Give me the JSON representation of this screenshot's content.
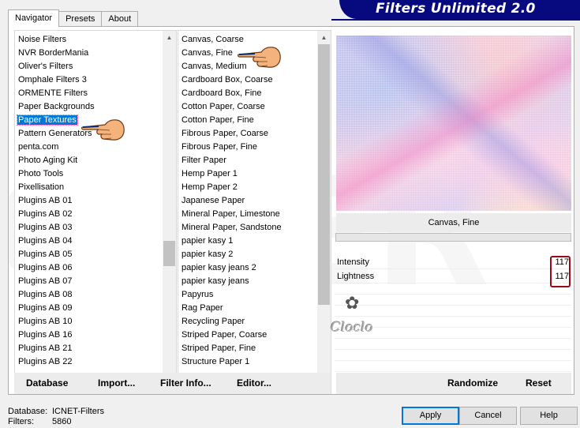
{
  "tabs": [
    {
      "label": "Navigator",
      "active": true
    },
    {
      "label": "Presets",
      "active": false
    },
    {
      "label": "About",
      "active": false
    }
  ],
  "banner": {
    "title": "Filters Unlimited 2.0"
  },
  "watermark": "OWER",
  "categories": {
    "items": [
      "Noise Filters",
      "NVR BorderMania",
      "Oliver's Filters",
      "Omphale Filters 3",
      "ORMENTE Filters",
      "Paper Backgrounds",
      "Paper Textures",
      "Pattern Generators",
      "penta.com",
      "Photo Aging Kit",
      "Photo Tools",
      "Pixellisation",
      "Plugins AB 01",
      "Plugins AB 02",
      "Plugins AB 03",
      "Plugins AB 04",
      "Plugins AB 05",
      "Plugins AB 06",
      "Plugins AB 07",
      "Plugins AB 08",
      "Plugins AB 09",
      "Plugins AB 10",
      "Plugins AB 16",
      "Plugins AB 21",
      "Plugins AB 22"
    ],
    "selected": "Paper Textures"
  },
  "filters": {
    "items": [
      "Canvas, Coarse",
      "Canvas, Fine",
      "Canvas, Medium",
      "Cardboard Box, Coarse",
      "Cardboard Box, Fine",
      "Cotton Paper, Coarse",
      "Cotton Paper, Fine",
      "Fibrous Paper, Coarse",
      "Fibrous Paper, Fine",
      "Filter Paper",
      "Hemp Paper 1",
      "Hemp Paper 2",
      "Japanese Paper",
      "Mineral Paper, Limestone",
      "Mineral Paper, Sandstone",
      "papier kasy 1",
      "papier kasy 2",
      "papier kasy jeans 2",
      "papier kasy jeans",
      "Papyrus",
      "Rag Paper",
      "Recycling Paper",
      "Striped Paper, Coarse",
      "Striped Paper, Fine",
      "Structure Paper 1"
    ],
    "selected": "Canvas, Fine"
  },
  "preview": {
    "filter_name": "Canvas, Fine"
  },
  "params": [
    {
      "label": "Intensity",
      "value": "117"
    },
    {
      "label": "Lightness",
      "value": "117"
    }
  ],
  "logo": {
    "text": "Cloclo"
  },
  "left_buttons": [
    {
      "name": "database-button",
      "label": "Database"
    },
    {
      "name": "import-button",
      "label": "Import..."
    },
    {
      "name": "filter-info-button",
      "label": "Filter Info..."
    },
    {
      "name": "editor-button",
      "label": "Editor..."
    }
  ],
  "right_buttons": [
    {
      "name": "randomize-button",
      "label": "Randomize"
    },
    {
      "name": "reset-button",
      "label": "Reset"
    }
  ],
  "status": {
    "database_label": "Database:",
    "database_value": "ICNET-Filters",
    "filters_label": "Filters:",
    "filters_value": "5860"
  },
  "dialog_buttons": {
    "apply": "Apply",
    "cancel": "Cancel",
    "help": "Help"
  },
  "colors": {
    "banner": "#07097e",
    "selection": "#0078d7",
    "highlight_box": "#9e0a14"
  }
}
